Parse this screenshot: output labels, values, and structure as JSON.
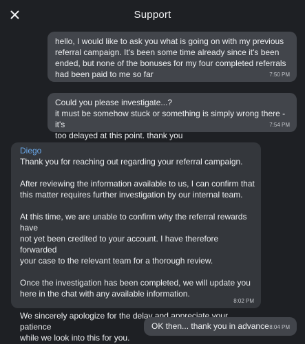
{
  "header": {
    "title": "Support",
    "close_icon": "close-icon"
  },
  "messages": [
    {
      "direction": "outgoing",
      "text": "hello, I would like to ask you what is going on with my previous\nreferral campaign. It's been some time already since it's been\nended, but none of the bonuses for my four completed referrals\nhad been paid to me so far",
      "time": "7:50 PM"
    },
    {
      "direction": "outgoing",
      "text": "Could you please investigate...?\nit must be somehow stuck or something is simply wrong there - it's\ntoo delayed at this point. thank you",
      "time": "7:54 PM"
    },
    {
      "direction": "incoming",
      "sender": "Diego",
      "paragraphs": [
        "Thank you for reaching out regarding your referral campaign.",
        "After reviewing the information available to us, I can confirm that\nthis matter requires further investigation by our internal team.",
        "At this time, we are unable to confirm why the referral rewards have\nnot yet been credited to your account. I have therefore forwarded\nyour case to the relevant team for a thorough review.",
        "Once the investigation has been completed, we will update you\nhere in the chat with any available information.",
        "We sincerely apologize for the delay and appreciate your patience\nwhile we look into this for you."
      ],
      "time": "8:02 PM"
    },
    {
      "direction": "outgoing",
      "text": "OK then... thank you in advance",
      "time": "8:04 PM"
    }
  ],
  "colors": {
    "background": "#1e2024",
    "outgoing_bubble": "#42454b",
    "incoming_bubble": "#34373c",
    "sender_name": "#6aa9ec"
  }
}
